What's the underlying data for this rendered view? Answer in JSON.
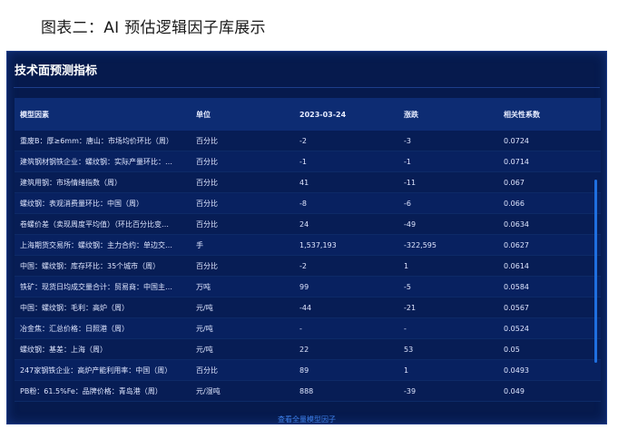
{
  "caption": "图表二：AI 预估逻辑因子库展示",
  "panel": {
    "title": "技术面预测指标",
    "footer_link": "查看全量模型因子"
  },
  "table": {
    "headers": [
      "模型因素",
      "单位",
      "2023-03-24",
      "涨跌",
      "相关性系数"
    ],
    "rows": [
      [
        "重废B：厚≥6mm：唐山：市场均价环比（周）",
        "百分比",
        "-2",
        "-3",
        "0.0724"
      ],
      [
        "建筑钢材钢铁企业：螺纹钢：实际产量环比：…",
        "百分比",
        "-1",
        "-1",
        "0.0714"
      ],
      [
        "建筑用钢：市场情绪指数（周）",
        "百分比",
        "41",
        "-11",
        "0.067"
      ],
      [
        "螺纹钢：表观消费量环比：中国（周）",
        "百分比",
        "-8",
        "-6",
        "0.066"
      ],
      [
        "卷螺价差（卖现周度平均值）（环比百分比变…",
        "百分比",
        "24",
        "-49",
        "0.0634"
      ],
      [
        "上海期货交易所：螺纹钢：主力合约：单边交…",
        "手",
        "1,537,193",
        "-322,595",
        "0.0627"
      ],
      [
        "中国：螺纹钢：库存环比：35个城市（周）",
        "百分比",
        "-2",
        "1",
        "0.0614"
      ],
      [
        "铁矿：现货日均成交量合计：贸易商：中国主…",
        "万吨",
        "99",
        "-5",
        "0.0584"
      ],
      [
        "中国：螺纹钢：毛利：高炉（周）",
        "元/吨",
        "-44",
        "-21",
        "0.0567"
      ],
      [
        "冶金焦：汇总价格：日照港（周）",
        "元/吨",
        "-",
        "-",
        "0.0524"
      ],
      [
        "螺纹钢：基差：上海（周）",
        "元/吨",
        "22",
        "53",
        "0.05"
      ],
      [
        "247家钢铁企业：高炉产能利用率：中国（周）",
        "百分比",
        "89",
        "1",
        "0.0493"
      ],
      [
        "PB粉：61.5%Fe：品牌价格：青岛港（周）",
        "元/湿吨",
        "888",
        "-39",
        "0.049"
      ]
    ]
  }
}
